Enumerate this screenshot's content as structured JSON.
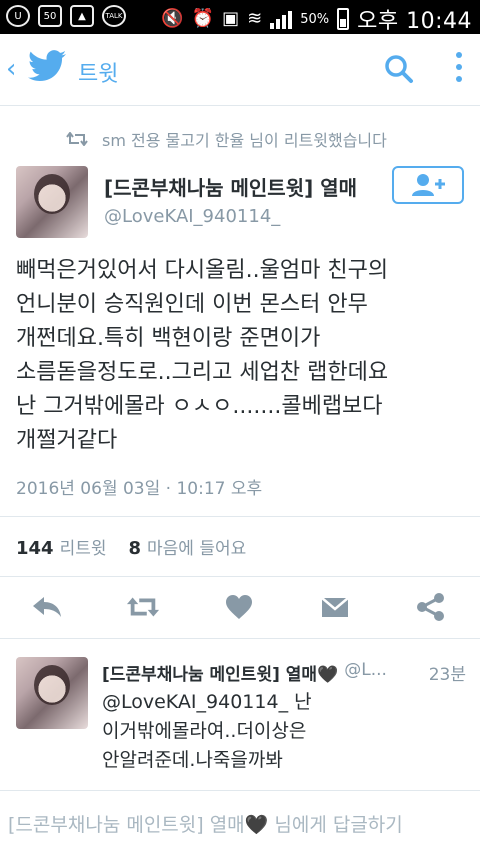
{
  "status_bar": {
    "icons": [
      "u-plus-icon",
      "notification-count-icon",
      "gallery-icon",
      "talk-icon"
    ],
    "badge_count": "50",
    "talk_label": "TALK",
    "battery": "50%",
    "time": "오후 10:44"
  },
  "app_bar": {
    "title": "트윗"
  },
  "retweet_note": "sm 전용 물고기 한율 님이 리트윗했습니다",
  "tweet": {
    "author_name": "[드콘부채나눔 메인트윗] 열매",
    "author_handle": "@LoveKAI_940114_",
    "text": "빼먹은거있어서 다시올림..울엄마 친구의\n언니분이 승직원인데 이번 몬스터 안무\n개쩐데요.특히 백현이랑 준면이가\n소름돋을정도로..그리고 세업찬 랩한데요\n난 그거밖에몰라 ㅇㅅㅇ.......콜베랩보다\n개쩔거같다",
    "timestamp": "2016년 06월 03일 · 10:17 오후",
    "retweet_count": "144",
    "retweet_label": "리트윗",
    "like_count": "8",
    "like_label": "마음에 들어요"
  },
  "reply": {
    "author_name": "[드콘부채나눔 메인트윗] 열매🖤",
    "author_handle": "@L...",
    "time": "23분",
    "text": "@LoveKAI_940114_ 난\n이거밖에몰라여..더이상은\n안알려준데.나죽을까봐"
  },
  "reply_input": {
    "placeholder": "[드콘부채나눔 메인트윗] 열매🖤 님에게 답글하기"
  },
  "colors": {
    "accent": "#55acee",
    "text": "#292f33",
    "muted": "#8899a6",
    "divider": "#e1e8ed"
  }
}
